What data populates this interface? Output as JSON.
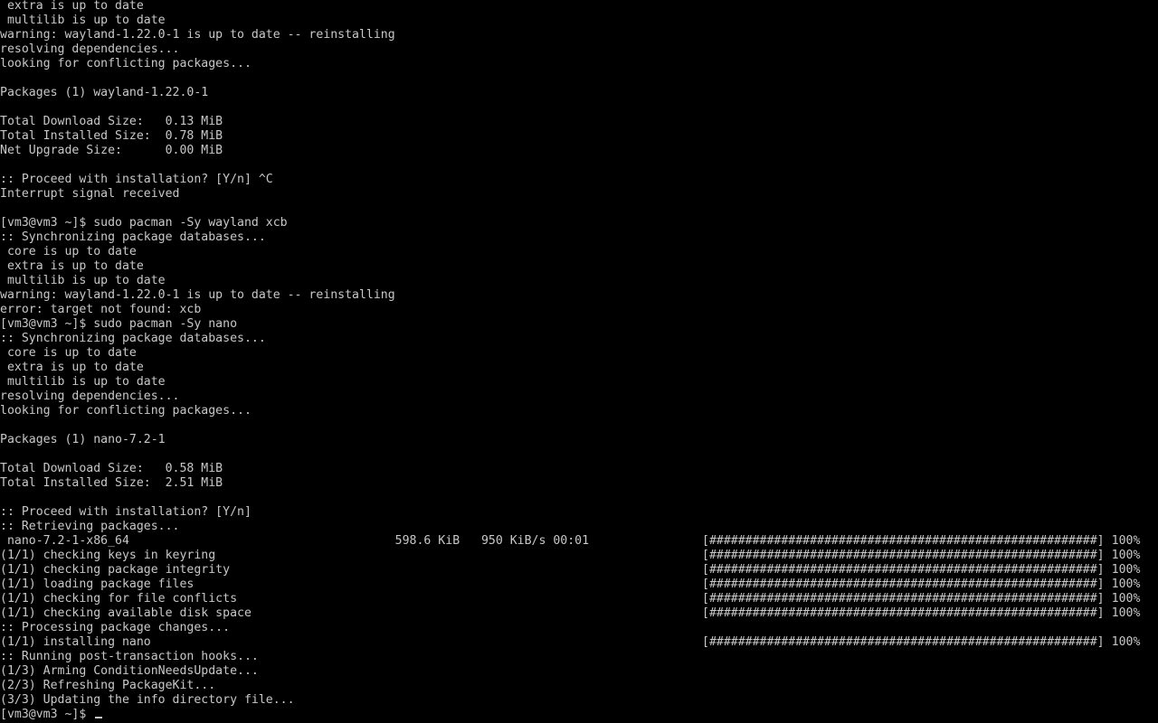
{
  "terminal": {
    "lines_top": [
      " extra is up to date",
      " multilib is up to date",
      "warning: wayland-1.22.0-1 is up to date -- reinstalling",
      "resolving dependencies...",
      "looking for conflicting packages...",
      "",
      "Packages (1) wayland-1.22.0-1",
      "",
      "Total Download Size:   0.13 MiB",
      "Total Installed Size:  0.78 MiB",
      "Net Upgrade Size:      0.00 MiB",
      "",
      ":: Proceed with installation? [Y/n] ^C",
      "Interrupt signal received",
      "",
      "[vm3@vm3 ~]$ sudo pacman -Sy wayland xcb",
      ":: Synchronizing package databases...",
      " core is up to date",
      " extra is up to date",
      " multilib is up to date",
      "warning: wayland-1.22.0-1 is up to date -- reinstalling",
      "error: target not found: xcb",
      "[vm3@vm3 ~]$ sudo pacman -Sy nano",
      ":: Synchronizing package databases...",
      " core is up to date",
      " extra is up to date",
      " multilib is up to date",
      "resolving dependencies...",
      "looking for conflicting packages...",
      "",
      "Packages (1) nano-7.2-1",
      "",
      "Total Download Size:   0.58 MiB",
      "Total Installed Size:  2.51 MiB",
      "",
      ":: Proceed with installation? [Y/n]",
      ":: Retrieving packages..."
    ],
    "download": {
      "label": " nano-7.2-1-x86_64                                     598.6 KiB   950 KiB/s 00:01",
      "bar": "[######################################################]",
      "percent": "100%"
    },
    "checks": [
      {
        "label": "(1/1) checking keys in keyring",
        "bar": "[######################################################]",
        "percent": "100%"
      },
      {
        "label": "(1/1) checking package integrity",
        "bar": "[######################################################]",
        "percent": "100%"
      },
      {
        "label": "(1/1) loading package files",
        "bar": "[######################################################]",
        "percent": "100%"
      },
      {
        "label": "(1/1) checking for file conflicts",
        "bar": "[######################################################]",
        "percent": "100%"
      },
      {
        "label": "(1/1) checking available disk space",
        "bar": "[######################################################]",
        "percent": "100%"
      }
    ],
    "processing": ":: Processing package changes...",
    "install": {
      "label": "(1/1) installing nano",
      "bar": "[######################################################]",
      "percent": "100%"
    },
    "lines_bottom": [
      ":: Running post-transaction hooks...",
      "(1/3) Arming ConditionNeedsUpdate...",
      "(2/3) Refreshing PackageKit...",
      "(3/3) Updating the info directory file..."
    ],
    "prompt": "[vm3@vm3 ~]$ "
  }
}
